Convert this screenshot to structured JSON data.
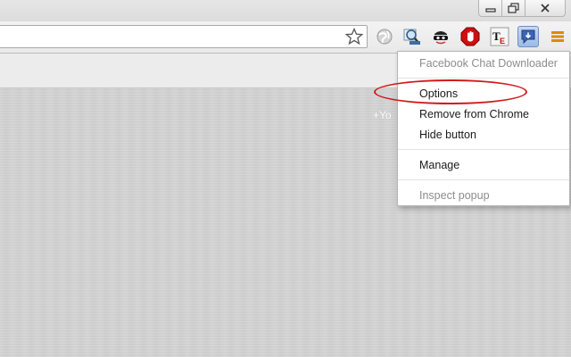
{
  "toolbar": {
    "omnibox_value": "",
    "icons": [
      "bookmark-star-icon",
      "globe-extension-icon",
      "magnifier-extension-icon",
      "spy-mask-extension-icon",
      "stop-adblock-extension-icon",
      "te-extension-icon",
      "facebook-chat-downloader-icon",
      "menu-icon"
    ]
  },
  "page": {
    "plus_you": "+Yo"
  },
  "context_menu": {
    "title": "Facebook Chat Downloader",
    "options": "Options",
    "remove": "Remove from Chrome",
    "hide": "Hide button",
    "manage": "Manage",
    "inspect": "Inspect popup"
  },
  "colors": {
    "highlight": "#d11a1a",
    "menu_icon": "#e08a00",
    "extension_pressed": "#9bbbe6"
  }
}
